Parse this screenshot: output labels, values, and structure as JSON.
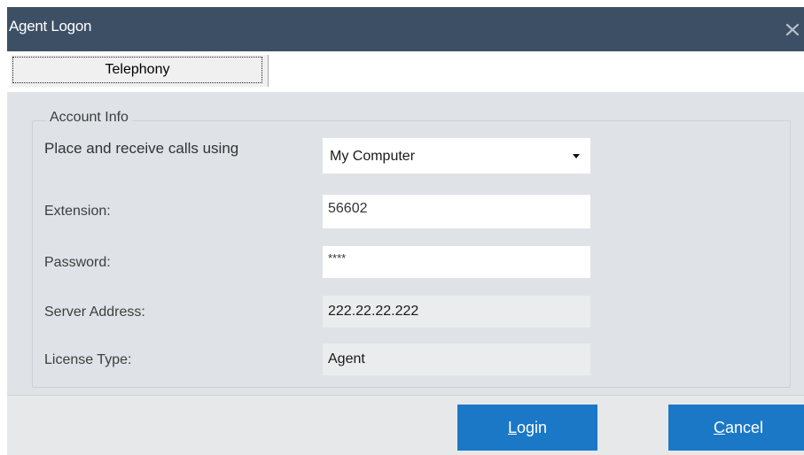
{
  "window": {
    "title": "Agent Logon"
  },
  "tabs": [
    {
      "label": "Telephony",
      "selected": true
    }
  ],
  "account_info": {
    "legend": "Account Info",
    "place_calls_label": "Place and receive calls using",
    "place_calls_value": "My Computer",
    "extension_label": "Extension:",
    "extension_value": "56602",
    "password_label": "Password:",
    "password_value": "****",
    "server_label": "Server Address:",
    "server_value": "222.22.22.222",
    "license_label": "License Type:",
    "license_value": "Agent"
  },
  "buttons": {
    "login_accel": "L",
    "login_rest": "ogin",
    "cancel_accel": "C",
    "cancel_rest": "ancel"
  },
  "colors": {
    "titlebar": "#3d4f64",
    "button": "#1b78c7",
    "panel": "#dfe3e7"
  },
  "icons": {
    "close": "close-icon",
    "dropdown": "chevron-down-icon"
  }
}
